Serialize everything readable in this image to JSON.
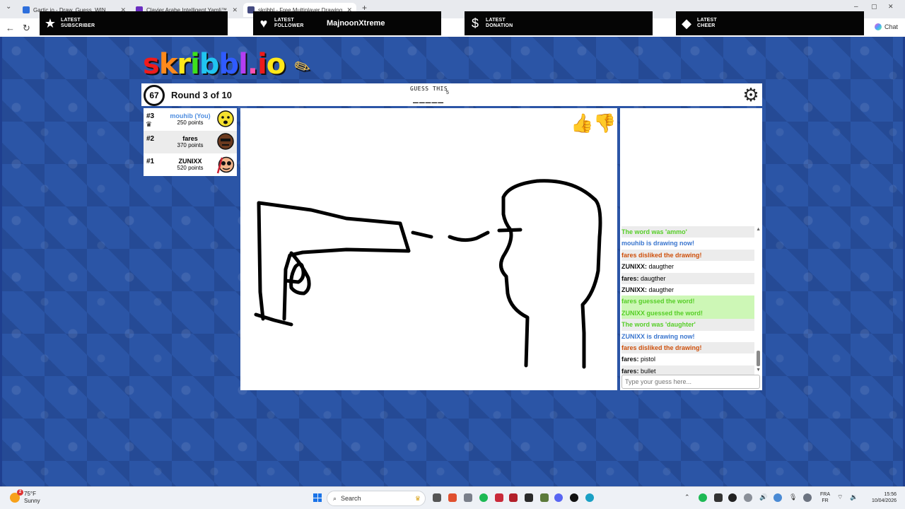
{
  "browser": {
    "tabs": [
      {
        "title": "Gartic.io - Draw, Guess, WIN",
        "color": "#2e6fdc"
      },
      {
        "title": "Clavier Arabe Intelligent Yamli™",
        "color": "#6a2ec0"
      },
      {
        "title": "skribbl - Free Multiplayer Drawing",
        "color": "#444a80"
      }
    ],
    "chat_label": "Chat"
  },
  "overlay": {
    "subscriber_label": "LATEST SUBSCRIBER",
    "follower_label": "LATEST FOLLOWER",
    "follower_value": "MajnoonXtreme",
    "donation_label": "LATEST DONATION",
    "cheer_label": "LATEST CHEER"
  },
  "game": {
    "logo": "skribbl.io",
    "timer": "67",
    "round": "Round 3 of 10",
    "guess_label": "GUESS THIS",
    "word_hint": "_____",
    "word_length": "5"
  },
  "players": [
    {
      "rank": "#3",
      "name": "mouhib (You)",
      "points": "250 points",
      "is_you": true,
      "crown": true
    },
    {
      "rank": "#2",
      "name": "fares",
      "points": "370 points",
      "is_you": false,
      "crown": false
    },
    {
      "rank": "#1",
      "name": "ZUNIXX",
      "points": "520 points",
      "is_you": false,
      "crown": false
    }
  ],
  "chat": {
    "messages": [
      {
        "text": "The word was 'ammo'",
        "color": "green",
        "bg": "gray"
      },
      {
        "text": "mouhib is drawing now!",
        "color": "blue",
        "bg": "white"
      },
      {
        "text": "fares disliked the drawing!",
        "color": "orange",
        "bg": "gray"
      },
      {
        "author": "ZUNIXX:",
        "text": " daugther",
        "bg": "white"
      },
      {
        "author": "fares:",
        "text": " daugther",
        "bg": "gray"
      },
      {
        "author": "ZUNIXX:",
        "text": " daugther",
        "bg": "white"
      },
      {
        "text": "fares guessed the word!",
        "color": "green",
        "bg": "greenbg"
      },
      {
        "text": "ZUNIXX guessed the word!",
        "color": "green",
        "bg": "greenbg"
      },
      {
        "text": "The word was 'daughter'",
        "color": "green",
        "bg": "gray"
      },
      {
        "text": "ZUNIXX is drawing now!",
        "color": "blue",
        "bg": "white"
      },
      {
        "text": "fares disliked the drawing!",
        "color": "orange",
        "bg": "gray"
      },
      {
        "author": "fares:",
        "text": " pistol",
        "bg": "white"
      },
      {
        "author": "fares:",
        "text": " bullet",
        "bg": "gray"
      }
    ],
    "input_placeholder": "Type your guess here..."
  },
  "taskbar": {
    "weather_temp": "75°F",
    "weather_desc": "Sunny",
    "weather_badge": "2",
    "search_label": "Search",
    "lang_top": "FRA",
    "lang_bottom": "FR",
    "time": "15:56",
    "date": "10/04/2026"
  },
  "colors": {
    "game_bg": "#2b55a6",
    "chat_green": "#56ce27",
    "chat_blue": "#3975ce",
    "chat_orange": "#ce4f0a",
    "you_name": "#4f8ee0"
  }
}
